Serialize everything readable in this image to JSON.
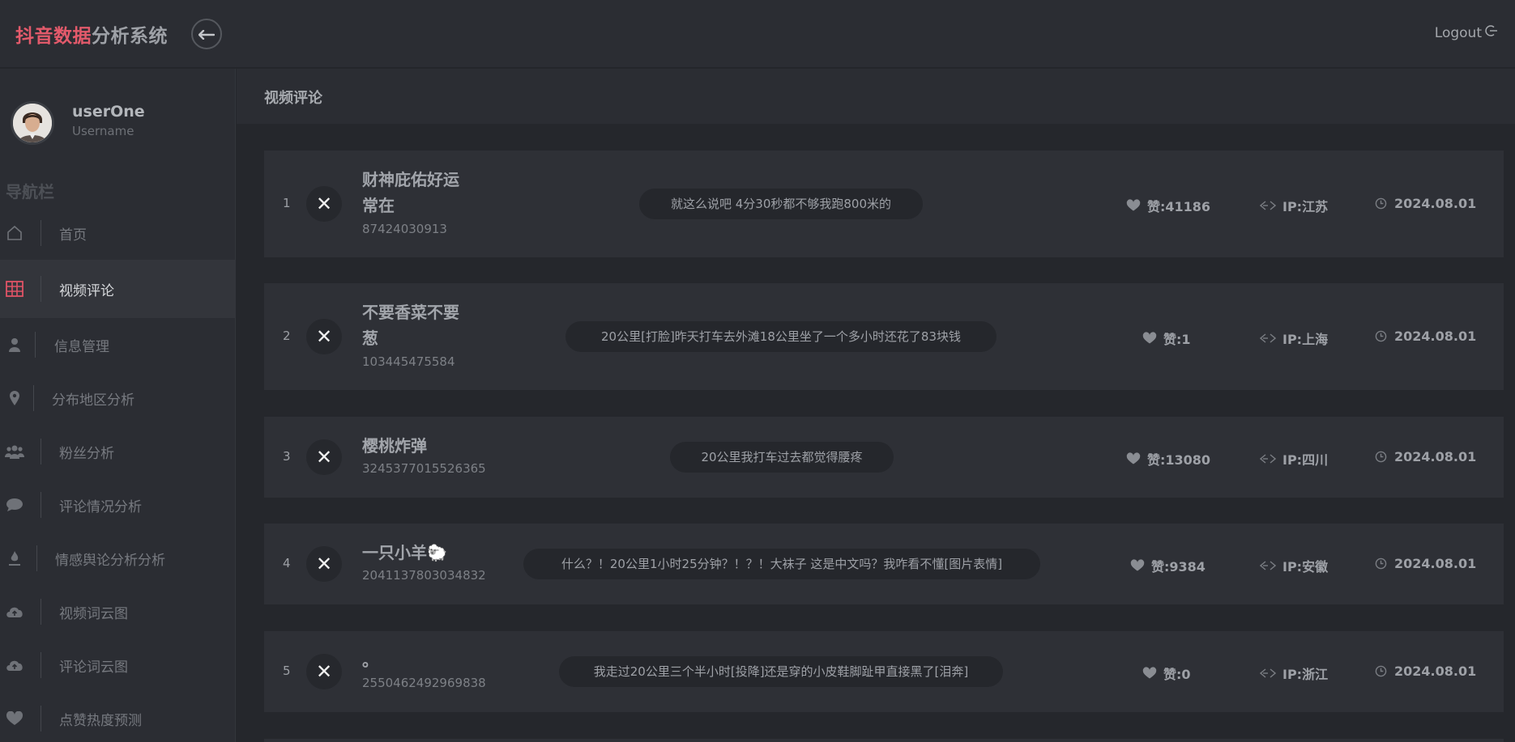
{
  "brand": {
    "accent": "抖音数据",
    "rest": "分析系统"
  },
  "header": {
    "logout_label": "Logout"
  },
  "profile": {
    "username": "userOne",
    "role": "Username"
  },
  "sidebar": {
    "title": "导航栏",
    "items": [
      {
        "label": "首页",
        "icon": "home-icon"
      },
      {
        "label": "视频评论",
        "icon": "grid-icon",
        "active": true
      },
      {
        "label": "信息管理",
        "icon": "user-icon"
      },
      {
        "label": "分布地区分析",
        "icon": "map-pin-icon"
      },
      {
        "label": "粉丝分析",
        "icon": "users-icon"
      },
      {
        "label": "评论情况分析",
        "icon": "comment-icon"
      },
      {
        "label": "情感舆论分析分析",
        "icon": "flame-icon"
      },
      {
        "label": "视频词云图",
        "icon": "cloud-upload-icon"
      },
      {
        "label": "评论词云图",
        "icon": "cloud-upload-icon"
      },
      {
        "label": "点赞热度预测",
        "icon": "heart-icon"
      }
    ]
  },
  "main": {
    "title": "视频评论"
  },
  "comments": [
    {
      "index": "1",
      "name": "财神庇佑好运常在",
      "uid": "87424030913",
      "text": "就这么说吧 4分30秒都不够我跑800米的",
      "likes": "赞:41186",
      "ip": "IP:江苏",
      "date": "2024.08.01"
    },
    {
      "index": "2",
      "name": "不要香菜不要葱",
      "uid": "103445475584",
      "text": "20公里[打脸]昨天打车去外滩18公里坐了一个多小时还花了83块钱",
      "likes": "赞:1",
      "ip": "IP:上海",
      "date": "2024.08.01"
    },
    {
      "index": "3",
      "name": "樱桃炸弹",
      "uid": "3245377015526365",
      "text": "20公里我打车过去都觉得腰疼",
      "likes": "赞:13080",
      "ip": "IP:四川",
      "date": "2024.08.01"
    },
    {
      "index": "4",
      "name": "一只小羊🐑",
      "uid": "2041137803034832",
      "text": "什么？！20公里1小时25分钟？！？！大袜子 这是中文吗？我咋看不懂[图片表情]",
      "likes": "赞:9384",
      "ip": "IP:安徽",
      "date": "2024.08.01"
    },
    {
      "index": "5",
      "name": "。",
      "uid": "2550462492969838",
      "text": "我走过20公里三个半小时[投降]还是穿的小皮鞋脚趾甲直接黑了[泪奔]",
      "likes": "赞:0",
      "ip": "IP:浙江",
      "date": "2024.08.01"
    }
  ],
  "colors": {
    "accent": "#e35a6b",
    "background": "#25272c",
    "panel": "#2b2d33",
    "card": "#2e3036"
  }
}
